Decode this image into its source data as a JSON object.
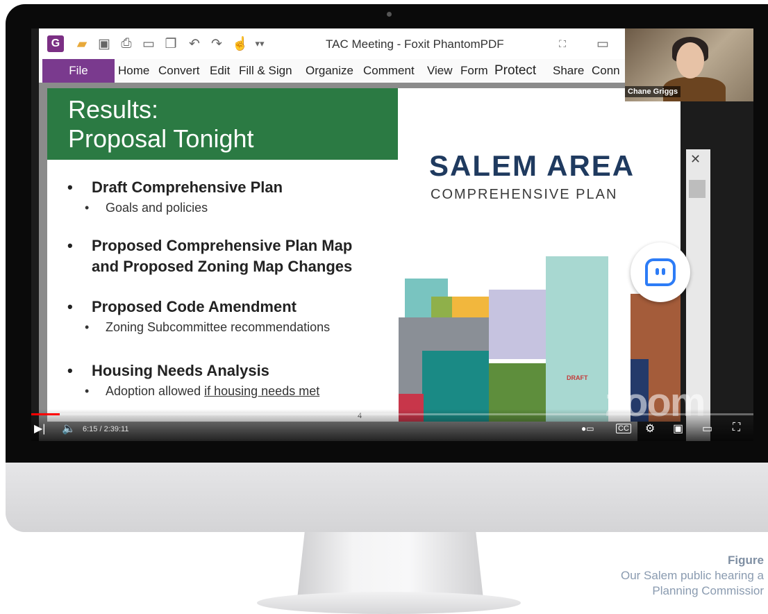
{
  "pdf": {
    "window_title": "TAC Meeting - Foxit PhantomPDF",
    "file_tab": "File",
    "menu": [
      "Home",
      "Convert",
      "Edit",
      "Fill & Sign",
      "Organize",
      "Comment",
      "View",
      "Form",
      "Protect",
      "Share",
      "Conn"
    ],
    "page_number": "4"
  },
  "slide": {
    "title_line1": "Results:",
    "title_line2": "Proposal Tonight",
    "bullets": [
      {
        "main": "Draft Comprehensive Plan",
        "sub": "Goals and policies"
      },
      {
        "main_line1": "Proposed Comprehensive Plan Map",
        "main_line2": "and Proposed Zoning Map Changes"
      },
      {
        "main": "Proposed Code Amendment",
        "sub": "Zoning Subcommittee recommendations"
      },
      {
        "main": "Housing Needs Analysis",
        "sub_prefix": "Adoption allowed ",
        "sub_link": "if housing needs met"
      }
    ],
    "logo_main": "SALEM AREA",
    "logo_sub": "COMPREHENSIVE PLAN",
    "cover_badge": "DRAFT"
  },
  "webcam": {
    "participant_name": "Chane Griggs"
  },
  "zoom_watermark": "zoom",
  "player": {
    "time": "6:15 / 2:39:11",
    "progress_fraction": 0.039
  },
  "caption": {
    "title": "Figure",
    "line1": "Our Salem public hearing a",
    "line2": "Planning Commissior"
  },
  "colors": {
    "slide_header": "#2b7a43",
    "file_tab": "#7a3a8e",
    "logo": "#1f3a5f",
    "progress": "#ff0000"
  }
}
